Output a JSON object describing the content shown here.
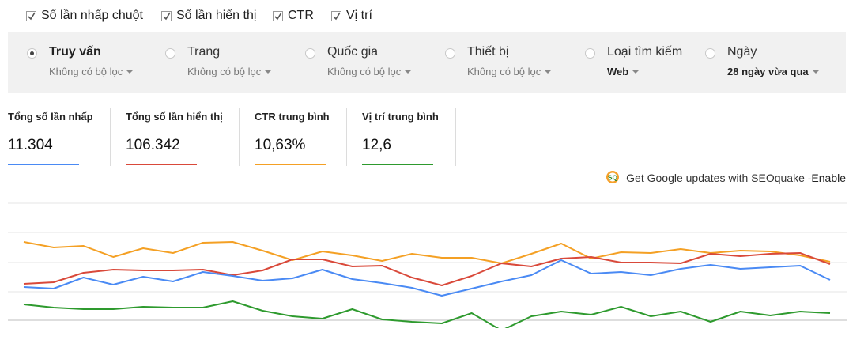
{
  "checkboxes": [
    {
      "label": "Số lần nhấp chuột",
      "checked": true
    },
    {
      "label": "Số lần hiển thị",
      "checked": true
    },
    {
      "label": "CTR",
      "checked": true
    },
    {
      "label": "Vị trí",
      "checked": true
    }
  ],
  "dimensions": [
    {
      "label": "Truy vấn",
      "sub": "Không có bộ lọc",
      "selected": true
    },
    {
      "label": "Trang",
      "sub": "Không có bộ lọc",
      "selected": false
    },
    {
      "label": "Quốc gia",
      "sub": "Không có bộ lọc",
      "selected": false
    },
    {
      "label": "Thiết bị",
      "sub": "Không có bộ lọc",
      "selected": false
    },
    {
      "label": "Loại tìm kiếm",
      "sub": "Web",
      "selected": false
    },
    {
      "label": "Ngày",
      "sub": "28 ngày vừa qua",
      "selected": false
    }
  ],
  "metrics": [
    {
      "label": "Tổng số lần nhấp",
      "value": "11.304",
      "color": "#4a8af4"
    },
    {
      "label": "Tổng số lần hiển thị",
      "value": "106.342",
      "color": "#d9493a"
    },
    {
      "label": "CTR trung bình",
      "value": "10,63%",
      "color": "#f4a024"
    },
    {
      "label": "Vị trí trung bình",
      "value": "12,6",
      "color": "#2e9a2e"
    }
  ],
  "promo": {
    "text": "Get Google updates with SEOquake - ",
    "link": "Enable",
    "icon": "seoquake-icon"
  },
  "chart_data": {
    "type": "line",
    "grid": true,
    "series": [
      {
        "color": "#f4a024",
        "values": [
          61,
          68,
          66,
          80,
          69,
          75,
          62,
          61,
          72,
          84,
          73,
          78,
          85,
          76,
          81,
          81,
          88,
          76,
          63,
          82,
          74,
          75,
          70,
          75,
          72,
          73,
          78,
          86
        ]
      },
      {
        "color": "#d9493a",
        "values": [
          114,
          112,
          100,
          96,
          97,
          97,
          96,
          103,
          97,
          83,
          83,
          92,
          91,
          106,
          116,
          104,
          88,
          92,
          82,
          80,
          87,
          87,
          88,
          76,
          79,
          76,
          75,
          89
        ]
      },
      {
        "color": "#4a8af4",
        "values": [
          118,
          120,
          106,
          115,
          105,
          111,
          99,
          104,
          110,
          107,
          96,
          108,
          113,
          119,
          129,
          120,
          111,
          103,
          84,
          101,
          99,
          103,
          95,
          90,
          95,
          93,
          91,
          109
        ]
      },
      {
        "color": "#2e9a2e",
        "values": [
          140,
          144,
          146,
          146,
          143,
          144,
          144,
          136,
          148,
          155,
          158,
          146,
          159,
          162,
          164,
          151,
          173,
          155,
          149,
          153,
          143,
          155,
          149,
          162,
          149,
          154,
          149,
          151
        ]
      }
    ]
  }
}
